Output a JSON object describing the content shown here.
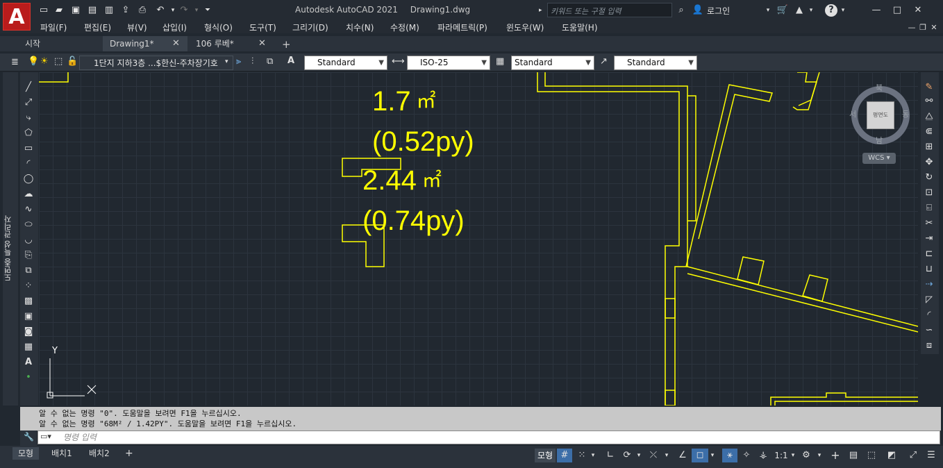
{
  "window": {
    "title_app": "Autodesk AutoCAD 2021",
    "title_doc": "Drawing1.dwg",
    "logo_letter": "A",
    "search_placeholder": "키워드 또는 구절 입력",
    "signin_label": "로그인"
  },
  "menu": [
    "파일(F)",
    "편집(E)",
    "뷰(V)",
    "삽입(I)",
    "형식(O)",
    "도구(T)",
    "그리기(D)",
    "치수(N)",
    "수정(M)",
    "파라메트릭(P)",
    "윈도우(W)",
    "도움말(H)"
  ],
  "tabs": [
    {
      "label": "시작",
      "closable": false
    },
    {
      "label": "Drawing1*",
      "closable": true,
      "active": true
    },
    {
      "label": "106 루베*",
      "closable": true
    }
  ],
  "properties": {
    "layer_name": "1단지 지하3층 ...$한신-주차장기호",
    "text_style": "Standard",
    "dim_style": "ISO-25",
    "table_style": "Standard",
    "mleader_style": "Standard"
  },
  "annotations": [
    {
      "value": "1.7",
      "unit": "㎡"
    },
    {
      "value": "(0.52py)"
    },
    {
      "value": "2.44",
      "unit": "㎡"
    },
    {
      "value": "(0.74py)"
    }
  ],
  "ucs": {
    "y": "Y"
  },
  "viewcube": {
    "north": "북",
    "south": "남",
    "west": "서",
    "east": "동",
    "face": "평면도",
    "wcs": "WCS"
  },
  "palette": {
    "label": "도면층 특성 관리자"
  },
  "command": {
    "history": [
      "알 수 없는 명령 \"0\".  도움말을 보려면 F1을 누르십시오.",
      "알 수 없는 명령 \"68M² / 1.42PY\".  도움말을 보려면 F1을 누르십시오."
    ],
    "placeholder": "명령 입력"
  },
  "layout_tabs": [
    "모형",
    "배치1",
    "배치2"
  ],
  "status": {
    "model": "모형",
    "scale": "1:1"
  },
  "colors": {
    "drawing_bg": "#212830",
    "entity": "#ffff00",
    "accent": "#3c6ea8"
  }
}
